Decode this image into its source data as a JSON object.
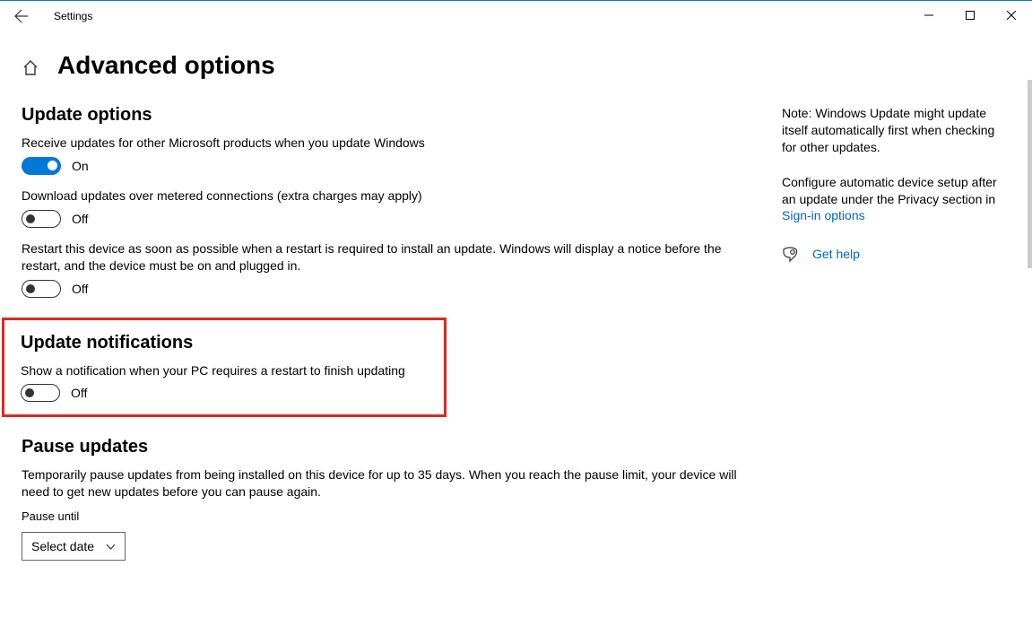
{
  "app_title": "Settings",
  "page_title": "Advanced options",
  "sections": {
    "update_options": {
      "heading": "Update options",
      "items": [
        {
          "desc": "Receive updates for other Microsoft products when you update Windows",
          "state": "On"
        },
        {
          "desc": "Download updates over metered connections (extra charges may apply)",
          "state": "Off"
        },
        {
          "desc": "Restart this device as soon as possible when a restart is required to install an update. Windows will display a notice before the restart, and the device must be on and plugged in.",
          "state": "Off"
        }
      ]
    },
    "update_notifications": {
      "heading": "Update notifications",
      "items": [
        {
          "desc": "Show a notification when your PC requires a restart to finish updating",
          "state": "Off"
        }
      ]
    },
    "pause_updates": {
      "heading": "Pause updates",
      "desc": "Temporarily pause updates from being installed on this device for up to 35 days. When you reach the pause limit, your device will need to get new updates before you can pause again.",
      "label": "Pause until",
      "select_text": "Select date"
    }
  },
  "sidebar": {
    "note": "Note: Windows Update might update itself automatically first when checking for other updates.",
    "configure_pre": "Configure automatic device setup after an update under the Privacy section in ",
    "configure_link": "Sign-in options",
    "help": "Get help"
  }
}
